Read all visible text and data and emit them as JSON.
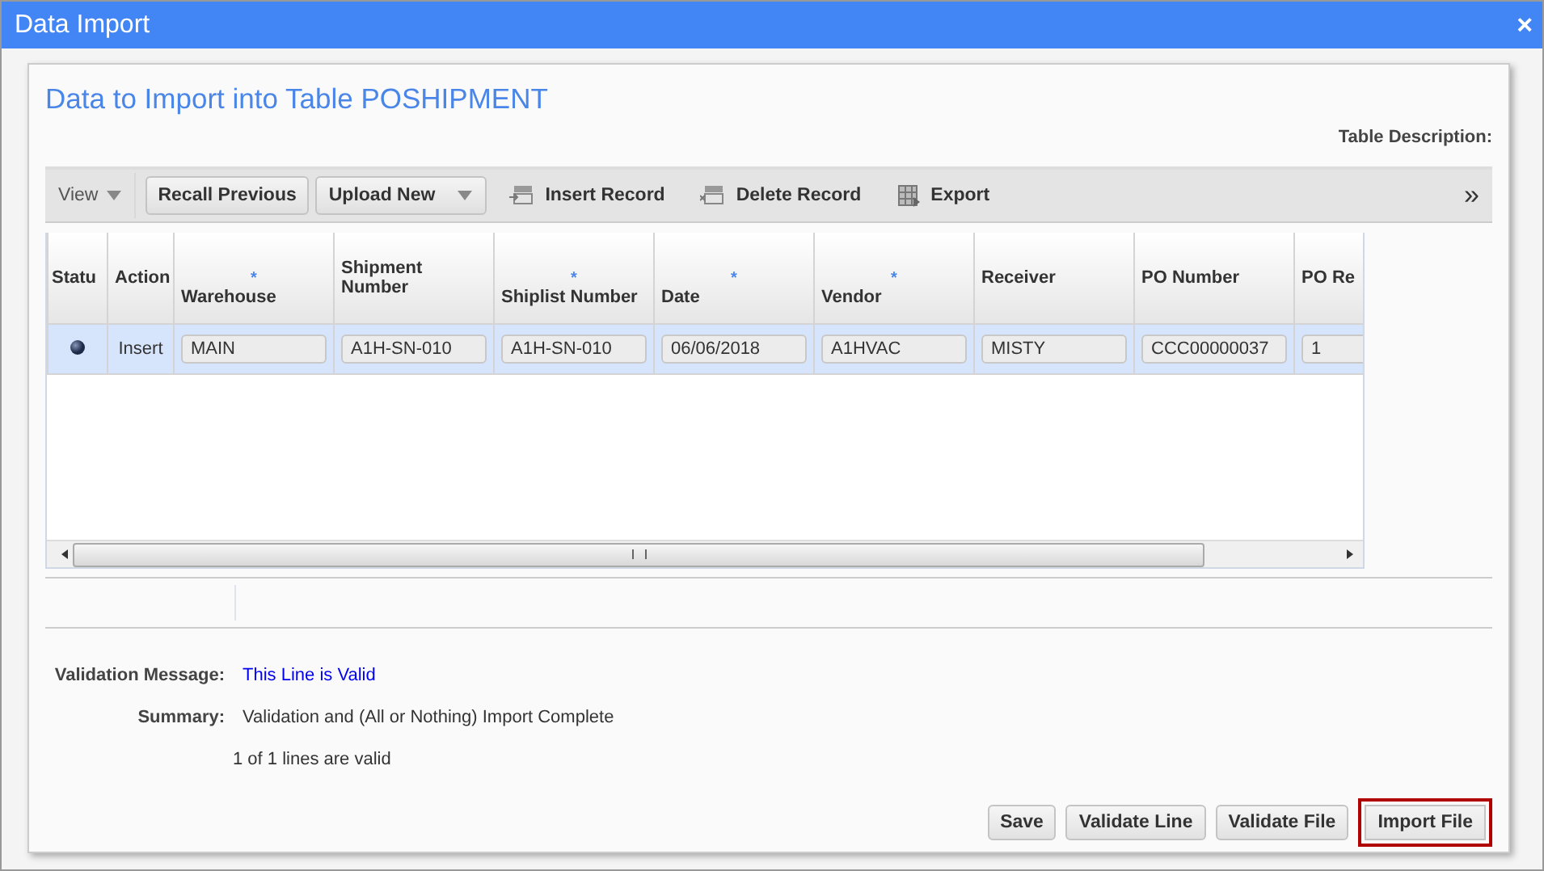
{
  "window": {
    "title": "Data Import",
    "close": "×"
  },
  "heading": "Data to Import into Table POSHIPMENT",
  "table_description_label": "Table Description:",
  "toolbar": [
    {
      "kind": "menu",
      "label": "View"
    },
    {
      "kind": "button",
      "label": "Recall Previous"
    },
    {
      "kind": "dropdown",
      "label": "Upload New"
    },
    {
      "kind": "insert",
      "label": "Insert Record"
    },
    {
      "kind": "delete",
      "label": "Delete Record"
    },
    {
      "kind": "export",
      "label": "Export"
    }
  ],
  "toolbar_more": "»",
  "table": {
    "columns": [
      {
        "label": "Statu"
      },
      {
        "label": "Action"
      },
      {
        "label": "Warehouse",
        "marker": "*"
      },
      {
        "label": "Shipment Number"
      },
      {
        "label": "Shiplist Number",
        "marker": "*"
      },
      {
        "label": "Date",
        "marker": "*"
      },
      {
        "label": "Vendor",
        "marker": "*"
      },
      {
        "label": "Receiver"
      },
      {
        "label": "PO Number"
      },
      {
        "label": "PO Re"
      }
    ],
    "rows": [
      {
        "selected": true,
        "action": "Insert",
        "values": [
          "MAIN",
          "A1H-SN-010",
          "A1H-SN-010",
          "06/06/2018",
          "A1HVAC",
          "MISTY",
          "CCC00000037",
          "1"
        ]
      }
    ]
  },
  "validation": {
    "message_label": "Validation Message:",
    "message": "This Line is Valid",
    "summary_label": "Summary:",
    "summary": "Validation and (All or Nothing) Import Complete",
    "count": "1 of 1 lines are valid"
  },
  "buttons": [
    {
      "label": "Save",
      "highlighted": false
    },
    {
      "label": "Validate Line",
      "highlighted": false
    },
    {
      "label": "Validate File",
      "highlighted": false
    },
    {
      "label": "Import File",
      "highlighted": true
    }
  ]
}
